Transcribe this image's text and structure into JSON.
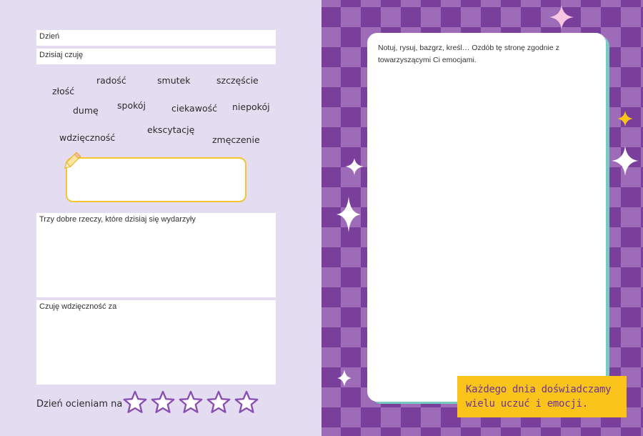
{
  "journal": {
    "day_label": "Dzień",
    "feel_label": "Dzisiaj czuję",
    "emotions": [
      "radość",
      "smutek",
      "szczęście",
      "złość",
      "spokój",
      "ciekawość",
      "niepokój",
      "dumę",
      "wdzięczność",
      "ekscytację",
      "zmęczenie"
    ],
    "three_good_label": "Trzy dobre rzeczy, które dzisiaj się wydarzyły",
    "gratitude_label": "Czuję wdzięczność za",
    "rating_label": "Dzień ocieniam na",
    "rating_max": 5,
    "rating_value": 0
  },
  "right": {
    "instruction": "Notuj, rysuj, bazgrz, kreśl… Ozdób tę stronę zgodnie z towarzyszącymi Ci emocjami.",
    "banner_line1": "Każdego dnia doświadczamy",
    "banner_line2": "wielu uczuć i emocji."
  },
  "colors": {
    "left_bg": "#e4dcf1",
    "checker_dark": "#7a3f9a",
    "checker_light": "#9d6bb7",
    "accent_yellow": "#f7c52f",
    "teal_shadow": "#78cbc0",
    "star_purple": "#8a4fb3",
    "banner_text": "#6b3494"
  }
}
